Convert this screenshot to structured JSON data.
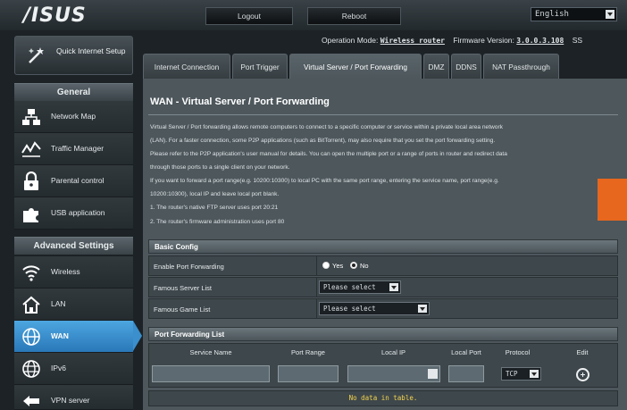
{
  "header": {
    "logo": "/ISUS",
    "logout_label": "Logout",
    "reboot_label": "Reboot",
    "language": "English"
  },
  "status": {
    "operation_mode_label": "Operation Mode:",
    "operation_mode_value": "Wireless router",
    "firmware_label": "Firmware Version:",
    "firmware_value": "3.0.0.3.108",
    "trailing": "SS"
  },
  "sidebar": {
    "quick_setup_label": "Quick Internet Setup",
    "general_heading": "General",
    "general_items": [
      {
        "label": "Network Map",
        "icon": "network-map-icon"
      },
      {
        "label": "Traffic Manager",
        "icon": "traffic-manager-icon"
      },
      {
        "label": "Parental control",
        "icon": "lock-icon"
      },
      {
        "label": "USB application",
        "icon": "puzzle-icon"
      }
    ],
    "advanced_heading": "Advanced Settings",
    "advanced_items": [
      {
        "label": "Wireless",
        "icon": "wifi-icon"
      },
      {
        "label": "LAN",
        "icon": "home-icon"
      },
      {
        "label": "WAN",
        "icon": "globe-icon",
        "active": true
      },
      {
        "label": "IPv6",
        "icon": "globe-ipv6-icon"
      },
      {
        "label": "VPN server",
        "icon": "vpn-icon"
      }
    ]
  },
  "tabs": [
    {
      "label": "Internet Connection"
    },
    {
      "label": "Port Trigger"
    },
    {
      "label": "Virtual Server / Port Forwarding",
      "active": true
    },
    {
      "label": "DMZ"
    },
    {
      "label": "DDNS"
    },
    {
      "label": "NAT Passthrough"
    }
  ],
  "page": {
    "title": "WAN - Virtual Server / Port Forwarding",
    "description_lines": [
      "Virtual Server / Port forwarding allows remote computers to connect to a specific computer or service within a private local area network",
      "(LAN). For a faster connection, some P2P applications (such as BitTorrent), may also require that you set the port forwarding setting.",
      "Please refer to the P2P application's user manual for details. You can open the multiple port or a range of ports in router and redirect data",
      "through those ports to a single client on your network.",
      "If you want to forward a port range(e.g. 10200:10300) to local PC with the same port range, entering the service name, port range(e.g.",
      "10200:10300), local IP and leave local port blank.",
      "1. The router's native FTP server uses port 20:21",
      "2. The router's firmware administration uses port 80"
    ]
  },
  "basic_config": {
    "heading": "Basic Config",
    "enable_label": "Enable Port Forwarding",
    "yes_label": "Yes",
    "no_label": "No",
    "enable_value": "no",
    "famous_server_label": "Famous Server List",
    "famous_server_value": "Please select",
    "famous_game_label": "Famous Game List",
    "famous_game_value": "Please select"
  },
  "port_list": {
    "heading": "Port Forwarding List",
    "columns": [
      "Service Name",
      "Port Range",
      "Local IP",
      "Local Port",
      "Protocol",
      "Edit"
    ],
    "protocol_value": "TCP",
    "empty_message": "No data in table."
  }
}
